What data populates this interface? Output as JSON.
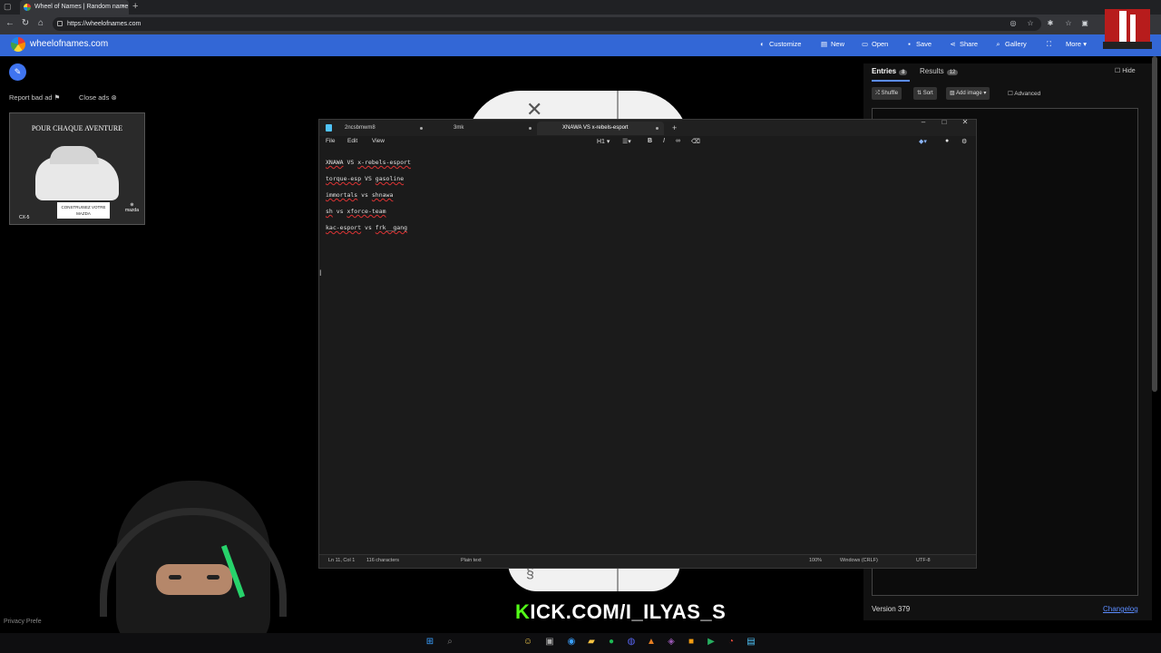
{
  "browser": {
    "tab_title": "Wheel of Names | Random name",
    "url": "https://wheelofnames.com"
  },
  "site": {
    "name": "wheelofnames.com",
    "menu": [
      "Customize",
      "New",
      "Open",
      "Save",
      "Share",
      "Gallery",
      "More"
    ]
  },
  "ad": {
    "report": "Report bad ad",
    "close": "Close ads",
    "headline": "POUR CHAQUE AVENTURE",
    "cta": "CONSTRUISEZ VOTRE MAZDA",
    "model": "CX-5",
    "brand": "mazda"
  },
  "privacy": "Privacy Prefe",
  "panel": {
    "tab_entries": "Entries",
    "entries_count": "8",
    "tab_results": "Results",
    "results_count": "12",
    "hide": "Hide",
    "shuffle": "Shuffle",
    "sort": "Sort",
    "add_image": "Add image",
    "advanced": "Advanced",
    "version": "Version 379",
    "changelog": "Changelog"
  },
  "notepad": {
    "tabs": [
      "2ncsbmwm8",
      "3mk",
      "XNAWA VS x-rebels-esport"
    ],
    "menu": [
      "File",
      "Edit",
      "View"
    ],
    "heading_tool": "H1",
    "lines": [
      {
        "a": "XNAWA",
        "b": " VS ",
        "c": "x-rebels-esport"
      },
      {
        "a": "torque-esp",
        "b": " VS ",
        "c": "gasoline"
      },
      {
        "a": "immortals",
        "b": " vs ",
        "c": "shnawa"
      },
      {
        "a": "sh",
        "b": " vs ",
        "c": "xforce-team"
      },
      {
        "a": "kac-esport",
        "b": " vs ",
        "c": "frk__gang"
      }
    ],
    "status": {
      "position": "Ln 11, Col 1",
      "chars": "116 characters",
      "format": "Plain text",
      "zoom": "100%",
      "eol": "Windows (CRLF)",
      "encoding": "UTF-8"
    }
  },
  "overlay": {
    "kick_first": "K",
    "kick_rest": "ICK.COM/I_ILYAS_S"
  }
}
